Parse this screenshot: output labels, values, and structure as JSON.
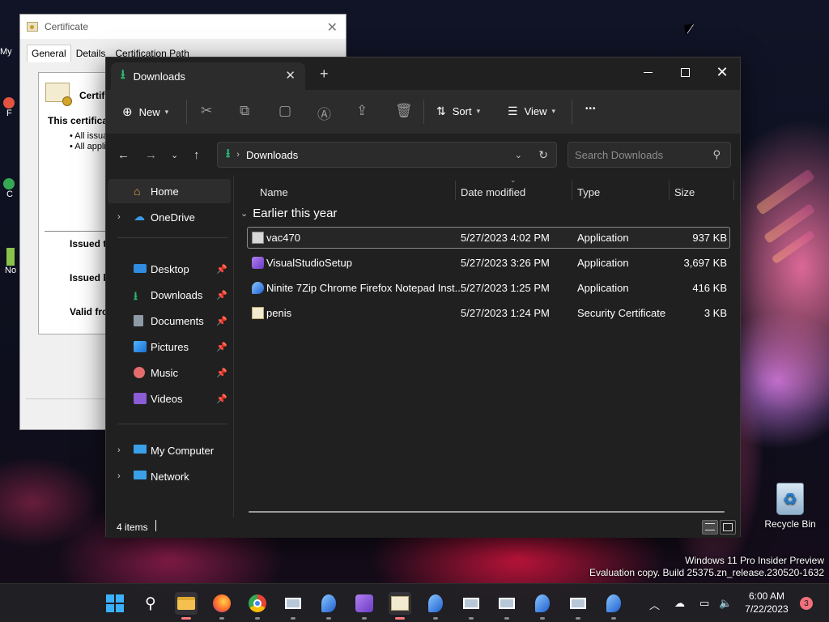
{
  "desktop": {
    "recycle_bin_label": "Recycle Bin",
    "watermark_line1": "Windows 11 Pro Insider Preview",
    "watermark_line2": "Evaluation copy. Build 25375.zn_release.230520-1632",
    "edge_fragments": [
      "My",
      "F",
      "C",
      "No"
    ]
  },
  "certificate": {
    "title": "Certificate",
    "tabs": [
      "General",
      "Details",
      "Certification Path"
    ],
    "heading": "Certif",
    "intro": "This certifica",
    "bullets": [
      "• All issua",
      "• All appli"
    ],
    "fields": [
      "Issued t",
      "Issued b",
      "Valid fro"
    ]
  },
  "explorer": {
    "tab_title": "Downloads",
    "toolbar": {
      "new_label": "New",
      "sort_label": "Sort",
      "view_label": "View",
      "more_label": "•••"
    },
    "address": {
      "crumb": "Downloads"
    },
    "search": {
      "placeholder": "Search Downloads"
    },
    "sidebar": {
      "home": "Home",
      "onedrive": "OneDrive",
      "pinned": [
        {
          "label": "Desktop",
          "icon": "desktop-folder-icon"
        },
        {
          "label": "Downloads",
          "icon": "downloads-folder-icon"
        },
        {
          "label": "Documents",
          "icon": "documents-folder-icon"
        },
        {
          "label": "Pictures",
          "icon": "pictures-folder-icon"
        },
        {
          "label": "Music",
          "icon": "music-folder-icon"
        },
        {
          "label": "Videos",
          "icon": "videos-folder-icon"
        }
      ],
      "my_computer": "My Computer",
      "network": "Network"
    },
    "columns": {
      "name": "Name",
      "date": "Date modified",
      "type": "Type",
      "size": "Size"
    },
    "group_label": "Earlier this year",
    "files": [
      {
        "name": "vac470",
        "date": "5/27/2023 4:02 PM",
        "type": "Application",
        "size": "937 KB"
      },
      {
        "name": "VisualStudioSetup",
        "date": "5/27/2023 3:26 PM",
        "type": "Application",
        "size": "3,697 KB"
      },
      {
        "name": "Ninite 7Zip Chrome Firefox Notepad Inst...",
        "date": "5/27/2023 1:25 PM",
        "type": "Application",
        "size": "416 KB"
      },
      {
        "name": "penis",
        "date": "5/27/2023 1:24 PM",
        "type": "Security Certificate",
        "size": "3 KB"
      }
    ],
    "status": {
      "item_count": "4 items"
    }
  },
  "taskbar": {
    "clock_time": "6:00 AM",
    "clock_date": "7/22/2023",
    "notification_count": "3"
  },
  "colors": {
    "accent_green": "#2bb673",
    "explorer_bg": "#202020",
    "toolbar_bg": "#2c2c2c"
  }
}
